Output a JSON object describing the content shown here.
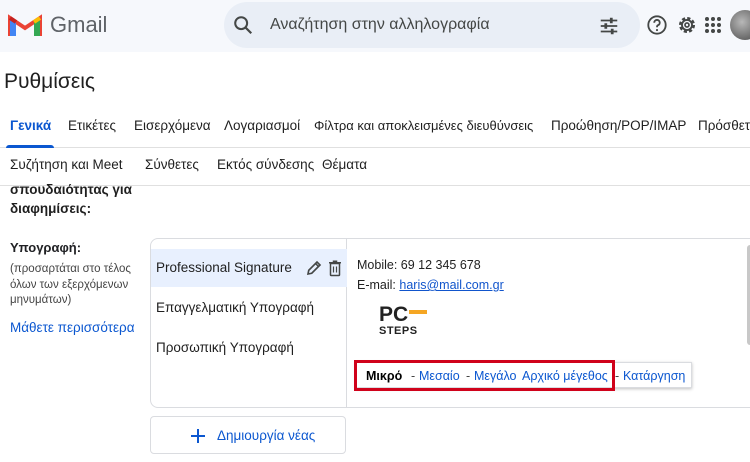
{
  "header": {
    "app_name": "Gmail",
    "search_placeholder": "Αναζήτηση στην αλληλογραφία",
    "icons": [
      "gmail-logo",
      "search-icon",
      "tune-icon",
      "help-icon",
      "gear-icon",
      "apps-icon",
      "avatar"
    ]
  },
  "page": {
    "title": "Ρυθμίσεις"
  },
  "tabs_row1": [
    {
      "label": "Γενικά",
      "active": true
    },
    {
      "label": "Ετικέτες"
    },
    {
      "label": "Εισερχόμενα"
    },
    {
      "label": "Λογαριασμοί"
    },
    {
      "label": "Φίλτρα και αποκλεισμένες διευθύνσεις"
    },
    {
      "label": "Προώθηση/POP/IMAP"
    },
    {
      "label": "Πρόσθετα"
    }
  ],
  "tabs_row2": [
    {
      "label": "Συζήτηση και Meet"
    },
    {
      "label": "Σύνθετες"
    },
    {
      "label": "Εκτός σύνδεσης"
    },
    {
      "label": "Θέματα"
    }
  ],
  "settings": {
    "prev_section_label_line1": "σπουδαιότητας για",
    "prev_section_label_line2": "διαφημίσεις:",
    "signature_label": "Υπογραφή:",
    "signature_desc_line1": "(προσαρτάται στο τέλος",
    "signature_desc_line2": "όλων των εξερχόμενων",
    "signature_desc_line3": "μηνυμάτων)",
    "learn_more": "Μάθετε περισσότερα"
  },
  "signatures": [
    {
      "name": "Professional Signature",
      "selected": true
    },
    {
      "name": "Επαγγελματική Υπογραφή"
    },
    {
      "name": "Προσωπική Υπογραφή"
    }
  ],
  "editor": {
    "mobile_line": "Mobile: 69 12 345 678",
    "email_prefix": "E-mail: ",
    "email_link": "haris@mail.com.gr",
    "logo_top": "PC",
    "logo_bottom": "STEPS"
  },
  "size_menu": {
    "options": [
      "Μικρό",
      "Μεσαίο",
      "Μεγάλο",
      "Αρχικό μέγεθος",
      "Κατάργηση"
    ],
    "separator": "-",
    "highlight_color": "#d0021b"
  },
  "new_button": {
    "label": "Δημιουργία νέας"
  },
  "colors": {
    "accent": "#0b57d0",
    "selected_bg": "#e8f0fe",
    "topbar_bg": "#f6f8fc"
  }
}
